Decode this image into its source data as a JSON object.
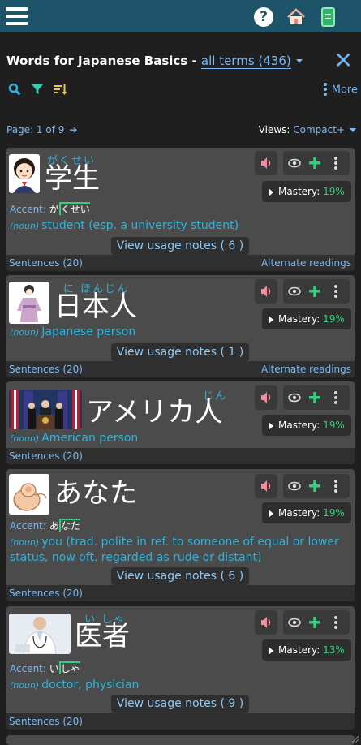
{
  "header": {
    "menu_icon": "hamburger-menu-icon",
    "help_icon": "help-icon",
    "help_glyph": "?",
    "home_icon": "home-icon",
    "book_icon": "book-icon"
  },
  "title": {
    "text": "Words for Japanese Basics - ",
    "link": "all terms (436)",
    "close": "✕"
  },
  "toolbar": {
    "more_label": "More"
  },
  "pagination": {
    "label": "Page: 1 of 9",
    "arrow": "➔",
    "views_label": "Views: ",
    "views_value": "Compact+"
  },
  "colors": {
    "topbar": "#1d5469",
    "link": "#7ab8f5",
    "meaning": "#2bb4e0",
    "mastery_pct": "#31d07a",
    "speaker": "#f28b9d",
    "plus": "#31d07a",
    "accent_mark": "#31d07a"
  },
  "cards": [
    {
      "word": "学生",
      "furigana": "がくせい",
      "accent_label": "Accent:",
      "accent_kana_before": "が",
      "accent_kana_after": "くせい",
      "pos": "(noun)",
      "meaning": "student (esp. a university student)",
      "usage": "View usage notes ( 6 )",
      "mastery_label": "Mastery:",
      "mastery_pct": "19%",
      "sentences": "Sentences (20)",
      "alternate": "Alternate readings",
      "thumb_icon": "student-girl-image"
    },
    {
      "word": "日本人",
      "furigana": "に ほんじん",
      "pos": "(noun)",
      "meaning": "Japanese person",
      "usage": "View usage notes ( 1 )",
      "mastery_label": "Mastery:",
      "mastery_pct": "19%",
      "sentences": "Sentences (20)",
      "alternate": "Alternate readings",
      "thumb_icon": "kimono-woman-image"
    },
    {
      "word": "アメリカ人",
      "furigana": "じん",
      "pos": "(noun)",
      "meaning": "American person",
      "mastery_label": "Mastery:",
      "mastery_pct": "19%",
      "sentences": "Sentences (20)",
      "thumb_icon": "american-podium-image"
    },
    {
      "word": "あなた",
      "accent_label": "Accent:",
      "accent_kana_before": "あ",
      "accent_kana_after": "なた",
      "pos": "(noun)",
      "meaning": "you (trad. polite in ref. to someone of equal or lower status, now oft. regarded as rude or distant)",
      "usage": "View usage notes ( 6 )",
      "mastery_label": "Mastery:",
      "mastery_pct": "19%",
      "sentences": "Sentences (20)",
      "thumb_icon": "pointing-finger-image"
    },
    {
      "word": "医者",
      "furigana": "い しゃ",
      "accent_label": "Accent:",
      "accent_kana_before": "い",
      "accent_kana_after": "しゃ",
      "pos": "(noun)",
      "meaning": "doctor, physician",
      "usage": "View usage notes ( 9 )",
      "mastery_label": "Mastery:",
      "mastery_pct": "13%",
      "sentences": "Sentences (20)",
      "thumb_icon": "doctor-image"
    }
  ]
}
